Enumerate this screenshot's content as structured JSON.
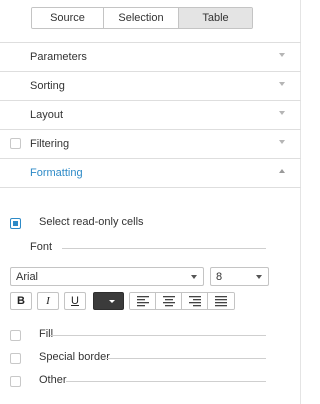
{
  "tabs": [
    {
      "label": "Source"
    },
    {
      "label": "Selection"
    },
    {
      "label": "Table"
    }
  ],
  "active_tab": "Table",
  "sections": {
    "parameters": "Parameters",
    "sorting": "Sorting",
    "layout": "Layout",
    "filtering": "Filtering",
    "formatting": "Formatting"
  },
  "formatting": {
    "select_readonly_label": "Select read-only cells",
    "select_readonly_checked": true,
    "font_label": "Font",
    "font_family": "Arial",
    "font_size": "8",
    "bold_label": "B",
    "italic_label": "I",
    "underline_label": "U",
    "font_color": "#3b3b3b",
    "fill_label": "Fill",
    "special_border_label": "Special border",
    "other_label": "Other"
  },
  "colors": {
    "accent": "#2d8ac7",
    "active_tab_bg": "#e4e4e4"
  }
}
